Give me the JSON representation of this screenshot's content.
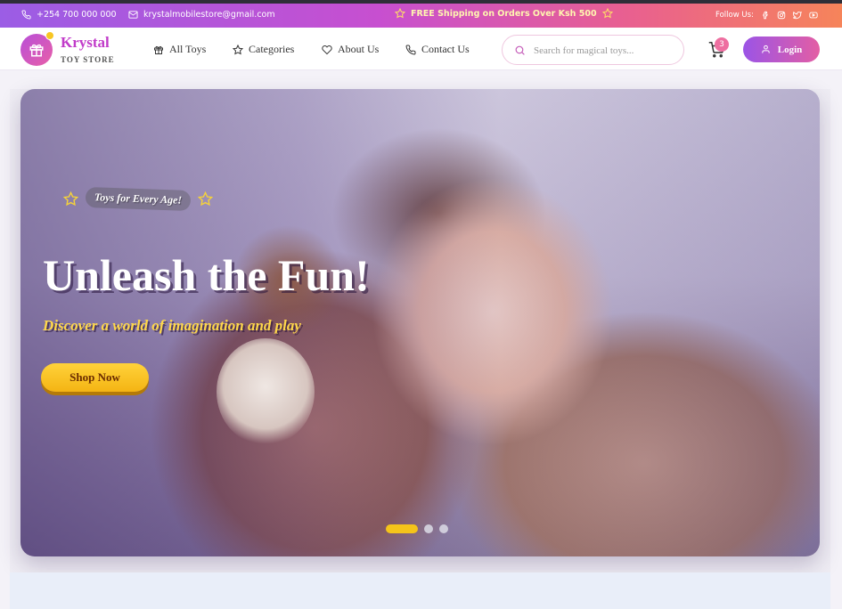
{
  "topbar": {
    "phone": "+254 700 000 000",
    "email": "krystalmobilestore@gmail.com",
    "shipping": "FREE Shipping on Orders Over Ksh 500",
    "follow_label": "Follow Us:",
    "social_icons": [
      "facebook-icon",
      "instagram-icon",
      "twitter-icon",
      "youtube-icon"
    ]
  },
  "nav": {
    "brand": "Krystal",
    "brand_sub": "TOY STORE",
    "links": [
      {
        "label": "All Toys",
        "icon": "gift-icon"
      },
      {
        "label": "Categories",
        "icon": "star-icon"
      },
      {
        "label": "About Us",
        "icon": "heart-icon"
      },
      {
        "label": "Contact Us",
        "icon": "phone-icon"
      }
    ],
    "search_placeholder": "Search for magical toys...",
    "cart_count": "3",
    "login_label": "Login"
  },
  "hero": {
    "tag": "Toys for Every Age!",
    "headline": "Unleash the Fun!",
    "subline": "Discover a world of imagination and play",
    "cta": "Shop Now",
    "slides_total": 3,
    "active_slide": 1
  },
  "colors": {
    "announce_gradient": [
      "#9b5de5",
      "#c74fd0",
      "#e9608f",
      "#f6845a"
    ],
    "brand": "#c13bc9",
    "accent_yellow": "#f5c41a",
    "cart_badge": "#ee6fa0"
  }
}
